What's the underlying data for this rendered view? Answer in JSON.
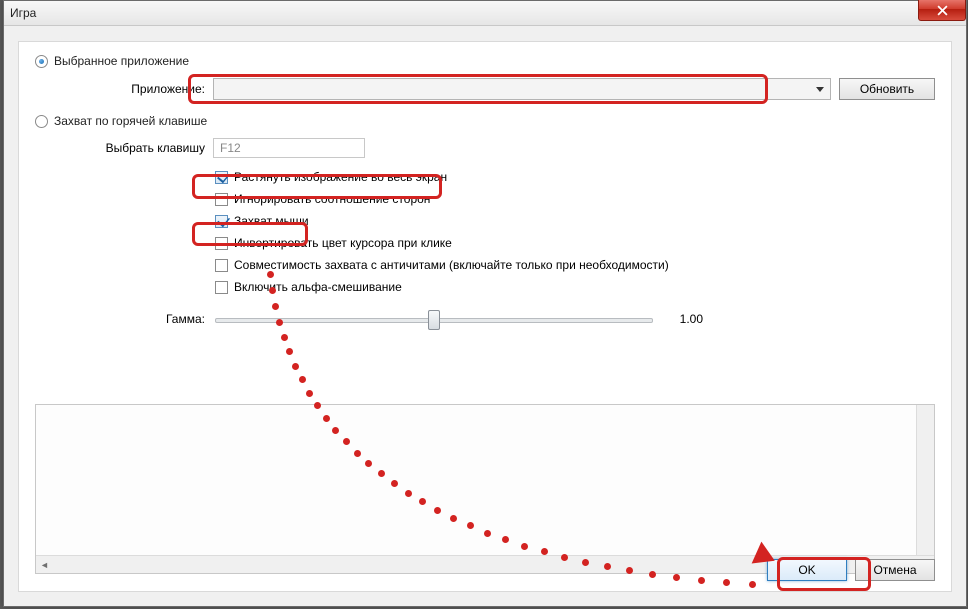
{
  "window": {
    "title": "Игра"
  },
  "radios": {
    "selected_app": "Выбранное приложение",
    "hotkey_capture": "Захват по горячей клавише"
  },
  "app_row": {
    "label": "Приложение:",
    "selected": "",
    "refresh": "Обновить"
  },
  "hotkey": {
    "label": "Выбрать клавишу",
    "value": "F12"
  },
  "checkboxes": {
    "stretch": {
      "label": "Растянуть изображение во весь экран",
      "checked": true
    },
    "ignore_ratio": {
      "label": "Игнорировать соотношение сторон",
      "checked": false
    },
    "capture_mouse": {
      "label": "Захват мыши",
      "checked": true
    },
    "invert_cursor": {
      "label": "Инвертировать цвет курсора при клике",
      "checked": false
    },
    "anticheat": {
      "label": "Совместимость захвата с античитами (включайте только при необходимости)",
      "checked": false
    },
    "alpha_blend": {
      "label": "Включить альфа-смешивание",
      "checked": false
    }
  },
  "gamma": {
    "label": "Гамма:",
    "value": "1.00",
    "pos_percent": 50
  },
  "buttons": {
    "ok": "OK",
    "cancel": "Отмена"
  }
}
